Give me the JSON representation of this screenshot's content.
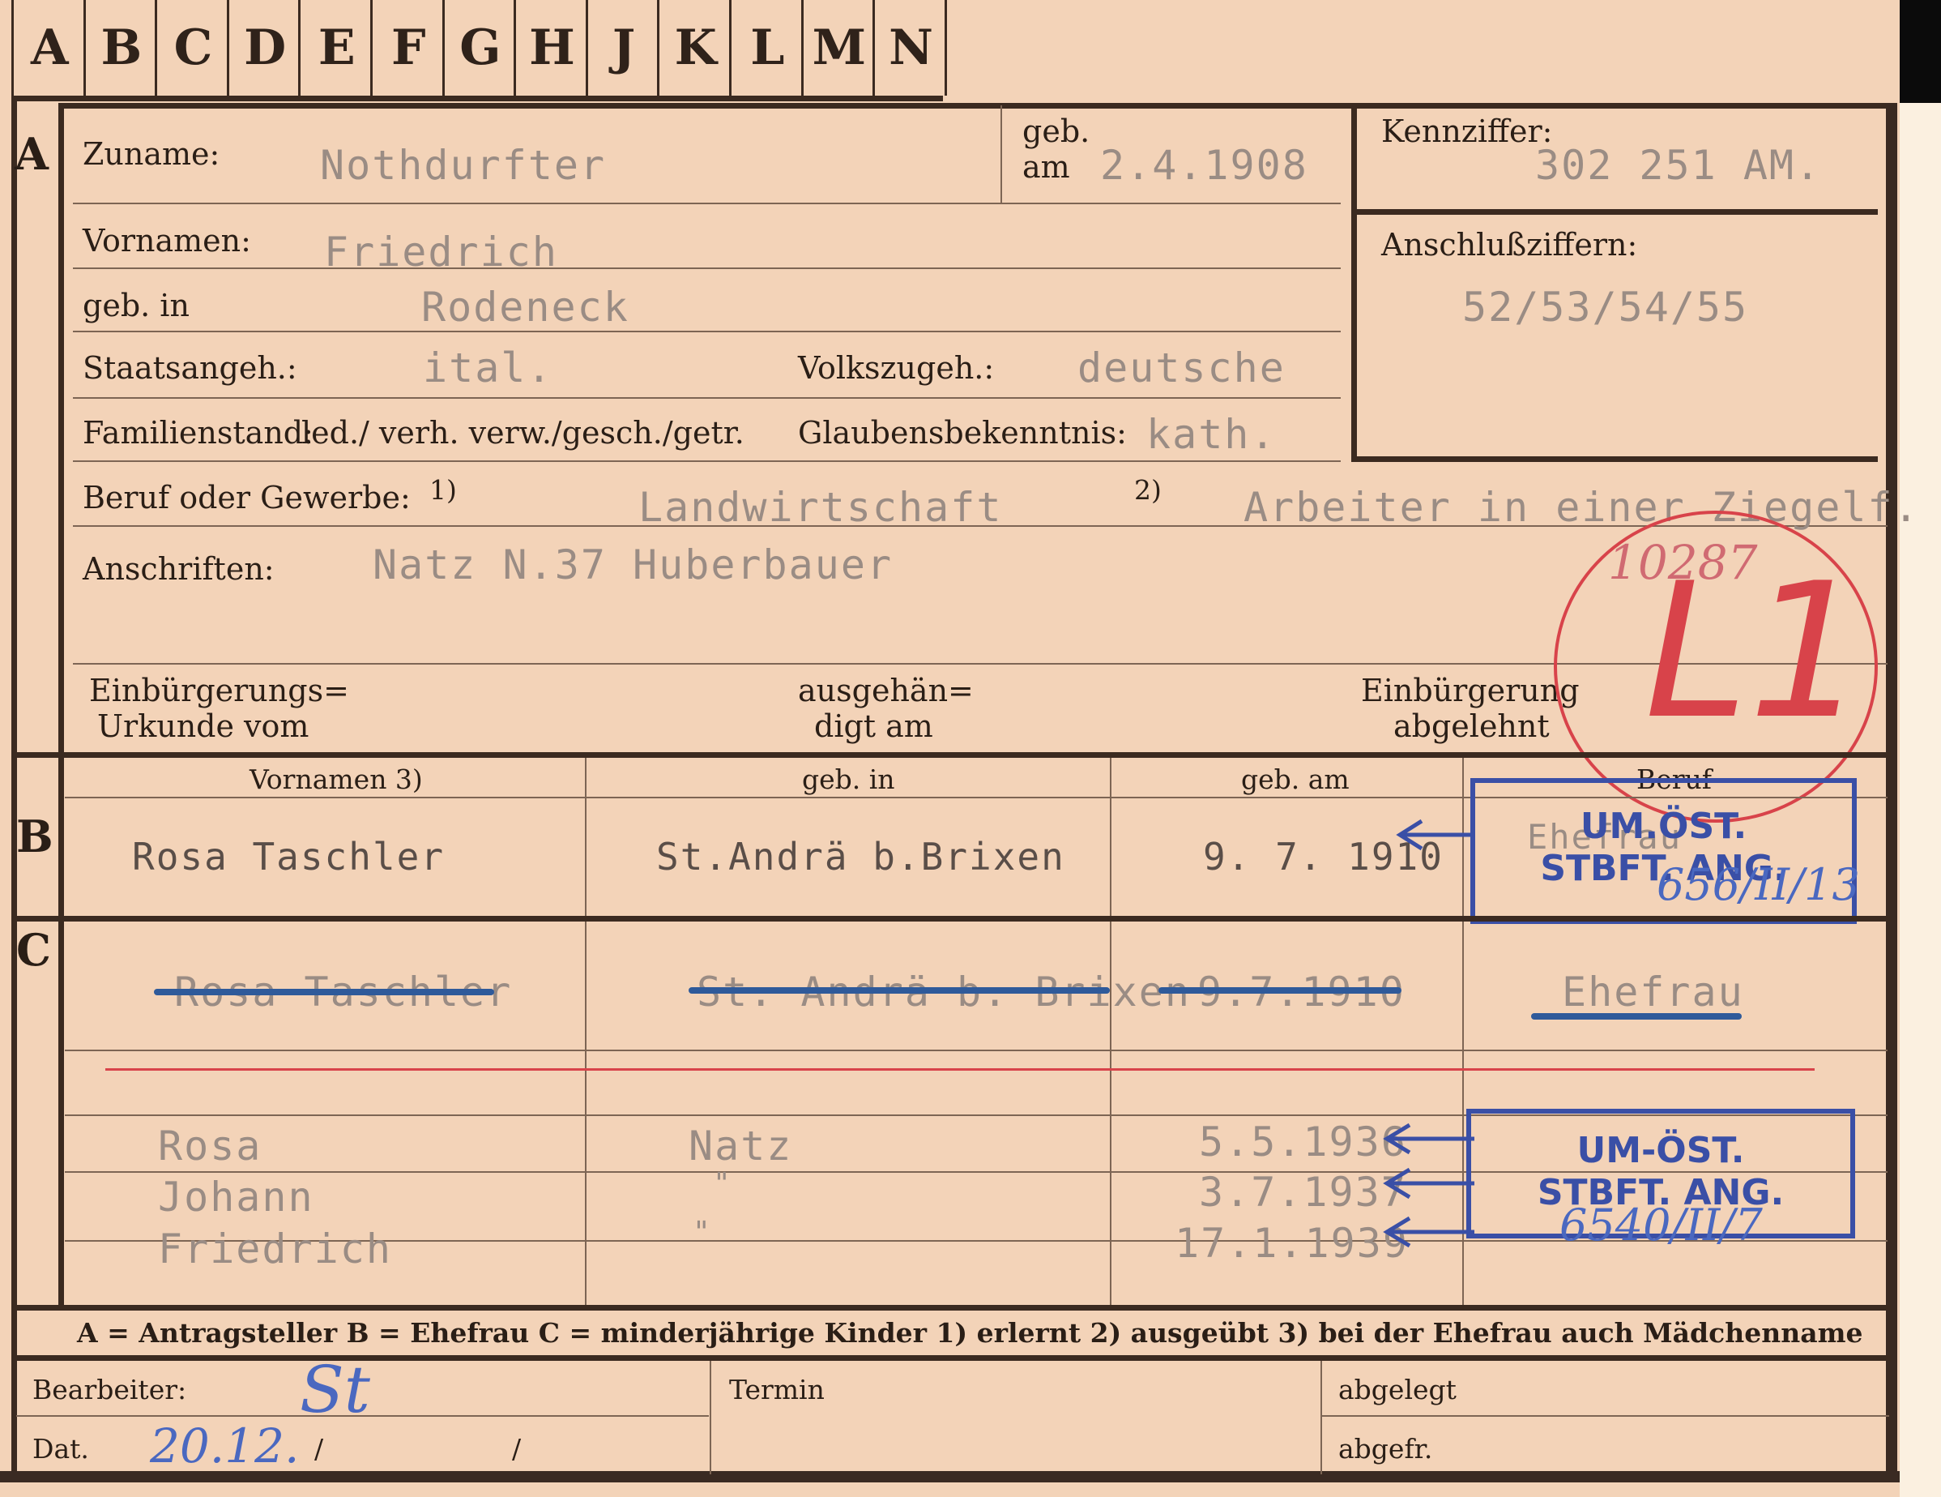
{
  "index_tabs": [
    "A",
    "B",
    "C",
    "D",
    "E",
    "F",
    "G",
    "H",
    "J",
    "K",
    "L",
    "M",
    "N"
  ],
  "section_A": {
    "letter": "A",
    "zuname_label": "Zuname:",
    "zuname_value": "Nothdurfter",
    "geb_am_label_1": "geb.",
    "geb_am_label_2": "am",
    "geb_am_value": "2.4.1908",
    "kennziffer_label": "Kennziffer:",
    "kennziffer_value": "302 251 AM.",
    "vornamen_label": "Vornamen:",
    "vornamen_value": "Friedrich",
    "anschluss_label": "Anschlußziffern:",
    "anschluss_value": "52/53/54/55",
    "geb_in_label": "geb. in",
    "geb_in_value": "Rodeneck",
    "staatsangeh_label": "Staatsangeh.:",
    "staatsangeh_value": "ital.",
    "volkszugeh_label": "Volkszugeh.:",
    "volkszugeh_value": "deutsche",
    "familienstand_label": "Familienstand:",
    "familienstand_options": "led./ verh. verw./gesch./getr.",
    "glaubens_label": "Glaubensbekenntnis:",
    "glaubens_value": "kath.",
    "beruf_label": "Beruf oder Gewerbe:",
    "beruf_sup1": "1)",
    "beruf_value_1": "Landwirtschaft",
    "beruf_sup2": "2)",
    "beruf_value_2": "Arbeiter in einer Ziegelf.",
    "anschriften_label": "Anschriften:",
    "anschriften_value": "Natz N.37 Huberbauer",
    "einbuerg_urkunde_1": "Einbürgerungs=",
    "einbuerg_urkunde_2": "Urkunde vom",
    "ausgehaen_1": "ausgehän=",
    "ausgehaen_2": "digt am",
    "abgelehnt_1": "Einbürgerung",
    "abgelehnt_2": "abgelehnt"
  },
  "red_stamp": {
    "number": "10287",
    "code": "L1"
  },
  "section_B": {
    "letter": "B",
    "headers": [
      "Vornamen 3)",
      "geb. in",
      "geb. am",
      "Beruf"
    ],
    "row": {
      "vornamen": "Rosa Taschler",
      "geb_in": "St.Andrä b.Brixen",
      "geb_am": "9. 7. 1910",
      "beruf": "Ehefrau"
    },
    "stamp": {
      "line1": "UM.ÖST.",
      "line2": "STBFT. ANG.",
      "note": "656/II/13"
    }
  },
  "section_C": {
    "letter": "C",
    "struck_row": {
      "vornamen": "Rosa Taschler",
      "geb_in": "St. Andrä b. Brixen",
      "geb_am": "9.7.1910",
      "beruf": "Ehefrau"
    },
    "children": [
      {
        "name": "Rosa",
        "place": "Natz",
        "date": "5.5.1936"
      },
      {
        "name": "Johann",
        "place": "\"",
        "date": "3.7.1937"
      },
      {
        "name": "Friedrich",
        "place": "\"",
        "date": "17.1.1939"
      }
    ],
    "stamp": {
      "line1": "UM-ÖST.",
      "line2": "STBFT. ANG.",
      "note": "6540/II/7"
    }
  },
  "legend": "A = Antragsteller  B = Ehefrau  C = minderjährige Kinder  1) erlernt  2) ausgeübt  3) bei der Ehefrau auch Mädchenname",
  "footer": {
    "bearbeiter_label": "Bearbeiter:",
    "bearbeiter_value": "St",
    "dat_label": "Dat.",
    "dat_value": "20.12.",
    "dat_slash_1": "/",
    "dat_slash_2": "/",
    "termin_label": "Termin",
    "abgelegt_label": "abgelegt",
    "abgefr_label": "abgefr."
  },
  "colors": {
    "card": "#f3d3b8",
    "ink": "#2a1e16",
    "typed": "#9a8c84",
    "stamp_blue": "#3a4fa6",
    "stamp_red": "#d8434a"
  }
}
